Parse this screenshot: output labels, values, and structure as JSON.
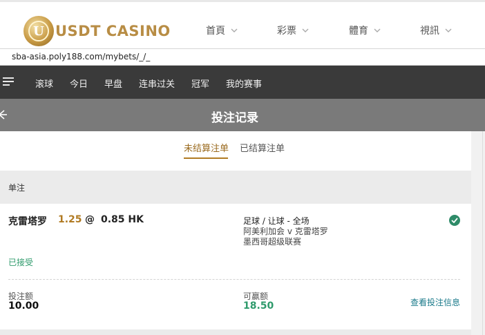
{
  "header": {
    "logo_text": "USDT CASINO",
    "logo_letter": "U",
    "nav": [
      {
        "label": "首頁"
      },
      {
        "label": "彩票"
      },
      {
        "label": "體育"
      },
      {
        "label": "視訊"
      }
    ]
  },
  "url": "sba-asia.poly188.com/mybets/_/_",
  "sport_nav": {
    "items": [
      "滚球",
      "今日",
      "早盘",
      "连串过关",
      "冠军",
      "我的赛事"
    ]
  },
  "page_title": "投注记录",
  "tabs": {
    "unsettled": "未结算注单",
    "settled": "已结算注单"
  },
  "section_title": "单注",
  "bet": {
    "selection": "克雷塔罗",
    "line": "1.25",
    "at": "@",
    "odds": "0.85 HK",
    "market": "足球 / 让球 - 全场",
    "match": "阿美利加会 v 克雷塔罗",
    "league": "墨西哥超级联赛",
    "status": "已接受",
    "stake_label": "投注额",
    "stake_value": "10.00",
    "win_label": "可赢额",
    "win_value": "18.50",
    "details_link": "查看投注信息"
  },
  "colors": {
    "gold": "#b07a22",
    "green": "#2e9a6b",
    "link": "#1a7a8a",
    "dark_bar": "#3a3a3a",
    "title_bar": "#7a7a7a"
  }
}
